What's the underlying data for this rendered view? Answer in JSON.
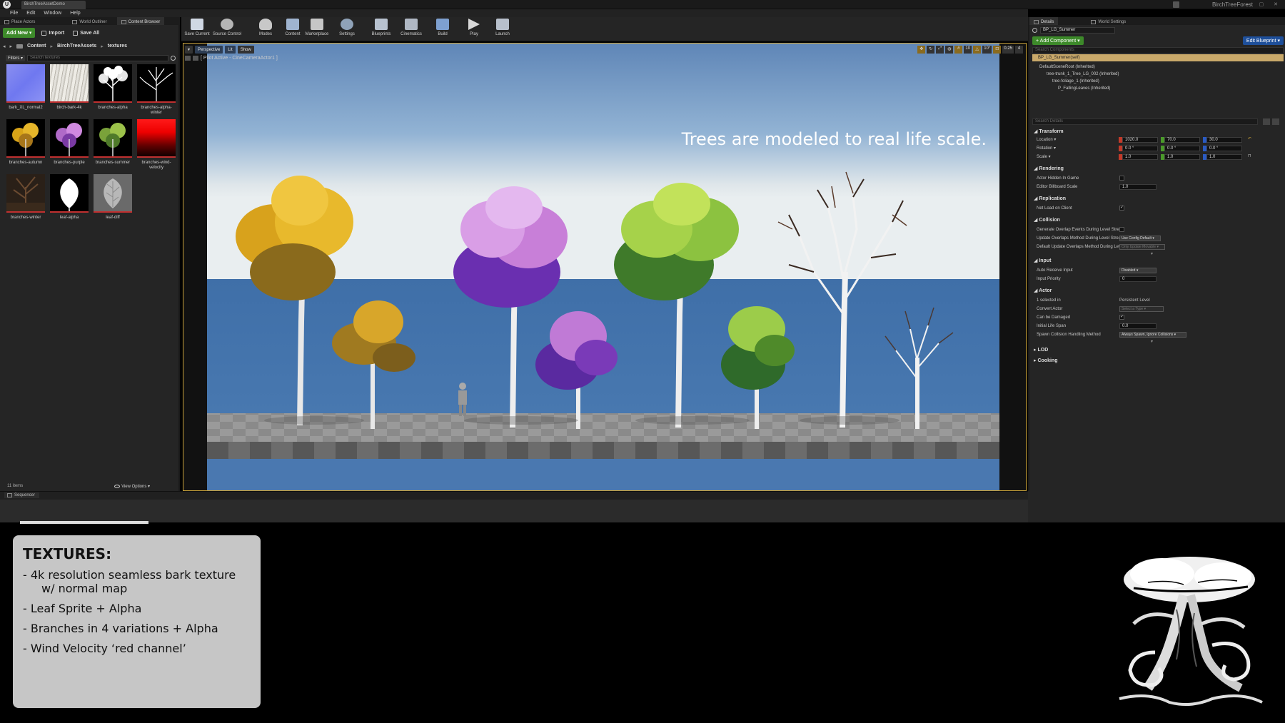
{
  "window": {
    "tab_title": "BirchTreeAssetDemo",
    "project_name": "BirchTreeForest"
  },
  "menu": [
    "File",
    "Edit",
    "Window",
    "Help"
  ],
  "left_tabs": [
    "Place Actors",
    "World Outliner",
    "Content Browser"
  ],
  "content_browser": {
    "add_new": "Add New ▾",
    "import": "Import",
    "save_all": "Save All",
    "path": [
      "Content",
      "BirchTreeAssets",
      "textures"
    ],
    "filters": "Filters ▾",
    "search_placeholder": "Search textures",
    "assets": [
      {
        "label": "bark_XL_normal2",
        "thumb": "normal"
      },
      {
        "label": "birch-bark-4k",
        "thumb": "bark"
      },
      {
        "label": "branches-alpha",
        "thumb": "branch-white"
      },
      {
        "label": "branches-alpha-winter",
        "thumb": "branch-winter-white"
      },
      {
        "label": "branches-autumn",
        "thumb": "autumn"
      },
      {
        "label": "branches-purple",
        "thumb": "purple"
      },
      {
        "label": "branches-summer",
        "thumb": "summer"
      },
      {
        "label": "branches-wind-velocity",
        "thumb": "red"
      },
      {
        "label": "branches-winter",
        "thumb": "winter"
      },
      {
        "label": "leaf-alpha",
        "thumb": "leaf-white"
      },
      {
        "label": "leaf-diff",
        "thumb": "leaf-grey"
      }
    ],
    "item_count": "11 items",
    "view_options": "View Options ▾"
  },
  "toolbar": [
    {
      "label": "Save Current",
      "icon": "save-icon"
    },
    {
      "label": "Source Control",
      "icon": "source-control-icon"
    },
    {
      "label": "Modes",
      "icon": "modes-icon"
    },
    {
      "label": "Content",
      "icon": "content-icon"
    },
    {
      "label": "Marketplace",
      "icon": "marketplace-icon"
    },
    {
      "label": "Settings",
      "icon": "settings-icon"
    },
    {
      "label": "Blueprints",
      "icon": "blueprints-icon"
    },
    {
      "label": "Cinematics",
      "icon": "cinematics-icon"
    },
    {
      "label": "Build",
      "icon": "build-icon"
    },
    {
      "label": "Play",
      "icon": "play-icon"
    },
    {
      "label": "Launch",
      "icon": "launch-icon"
    }
  ],
  "viewport": {
    "perspective": "Perspective",
    "lit": "Lit",
    "show": "Show",
    "pilot_status": "[ Pilot Active - CineCameraActor1 ]",
    "right_values": [
      "10",
      "10°",
      "0.25",
      "4"
    ],
    "caption": "Trees are modeled to real life scale."
  },
  "details": {
    "tabs": [
      "Details",
      "World Settings"
    ],
    "selected_name": "BP_LG_Summer",
    "add_component": "+ Add Component ▾",
    "edit_blueprint": "Edit Blueprint ▾",
    "search_components": "Search Components",
    "self_row": "BP_LG_Summer(self)",
    "component_tree": [
      "DefaultSceneRoot (Inherited)",
      "tree-trunk_1_Tree_LG_002 (Inherited)",
      "tree-foliage_1 (Inherited)",
      "P_FallingLeaves (Inherited)"
    ],
    "search_details": "Search Details",
    "transform": {
      "title": "Transform",
      "location_label": "Location ▾",
      "rotation_label": "Rotation ▾",
      "scale_label": "Scale ▾",
      "location": [
        "1020.0",
        "70.0",
        "30.0"
      ],
      "rotation": [
        "0.0 °",
        "0.0 °",
        "0.0 °"
      ],
      "scale": [
        "1.0",
        "1.0",
        "1.0"
      ]
    },
    "rendering": {
      "title": "Rendering",
      "hidden_label": "Actor Hidden In Game",
      "billboard_label": "Editor Billboard Scale",
      "billboard_value": "1.0"
    },
    "replication": {
      "title": "Replication",
      "net_load_label": "Net Load on Client"
    },
    "collision": {
      "title": "Collision",
      "gen_overlap_label": "Generate Overlap Events During Level Streaming",
      "update_overlap_label": "Update Overlaps Method During Level Streaming",
      "update_overlap_value": "Use Config Default ▾",
      "default_update_label": "Default Update Overlaps Method During Level Streaming",
      "default_update_value": "Only Update Movable ▾"
    },
    "input": {
      "title": "Input",
      "auto_receive_label": "Auto Receive Input",
      "auto_receive_value": "Disabled ▾",
      "priority_label": "Input Priority",
      "priority_value": "0"
    },
    "actor": {
      "title": "Actor",
      "selected_label": "1 selected in",
      "selected_value": "Persistent Level",
      "convert_label": "Convert Actor",
      "convert_value": "Select a Type ▾",
      "damaged_label": "Can be Damaged",
      "lifespan_label": "Initial Life Span",
      "lifespan_value": "0.0",
      "spawn_label": "Spawn Collision Handling Method",
      "spawn_value": "Always Spawn, Ignore Collisions ▾"
    },
    "lod": "LOD",
    "cooking": "Cooking"
  },
  "sequencer_tab": "Sequencer",
  "info_card": {
    "heading": "TEXTURES:",
    "items": [
      {
        "line1": "- 4k resolution seamless bark texture",
        "line2": "w/ normal map"
      },
      {
        "line1": "- Leaf Sprite + Alpha",
        "line2": ""
      },
      {
        "line1": "- Branches in 4 variations + Alpha",
        "line2": ""
      },
      {
        "line1": "- Wind Velocity ‘red channel’",
        "line2": ""
      }
    ]
  },
  "colors": {
    "accent_green": "#3d8a2a",
    "accent_blue": "#1e4f9a",
    "viewport_border": "#c9a23a",
    "selection": "#c9a96a"
  }
}
